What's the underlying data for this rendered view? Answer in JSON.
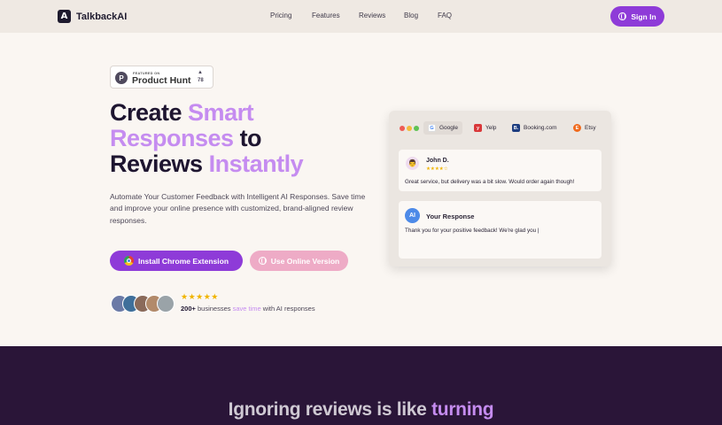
{
  "nav": {
    "brand": "TalkbackAI",
    "links": [
      "Pricing",
      "Features",
      "Reviews",
      "Blog",
      "FAQ"
    ],
    "signin_label": "Sign In"
  },
  "badge": {
    "featured": "FEATURED ON",
    "name": "Product Hunt",
    "votes": "78"
  },
  "hero": {
    "title_line1_a": "Create ",
    "title_line1_b": "Smart",
    "title_line2_a": "Responses",
    "title_line2_b": " to",
    "title_line3_a": "Reviews ",
    "title_line3_b": "Instantly",
    "description": "Automate Your Customer Feedback with Intelligent AI Responses. Save time and improve your online presence with customized, brand-aligned review responses.",
    "cta_primary": "Install Chrome Extension",
    "cta_secondary": "Use Online Version"
  },
  "proof": {
    "stars": "★★★★★",
    "count": "200+",
    "text_a": " businesses ",
    "text_hl": "save time",
    "text_b": " with AI responses"
  },
  "mockup": {
    "tabs": [
      {
        "label": "Google",
        "icon": "G"
      },
      {
        "label": "Yelp",
        "icon": "y"
      },
      {
        "label": "Booking.com",
        "icon": "B."
      },
      {
        "label": "Etsy",
        "icon": "E"
      }
    ],
    "review": {
      "author": "John D.",
      "stars": "★★★★☆",
      "text": "Great service, but delivery was a bit slow. Would order again though!"
    },
    "response": {
      "avatar": "AI",
      "title": "Your Response",
      "text": "Thank you for your positive feedback! We're glad you |"
    }
  },
  "section2": {
    "title_a": "Ignoring reviews is like ",
    "title_b": "turning"
  },
  "colors": {
    "accent": "#8e3bd8",
    "accent_light": "#c58cf0",
    "dark_bg": "#2a1538",
    "secondary_btn": "#eeabc6"
  }
}
